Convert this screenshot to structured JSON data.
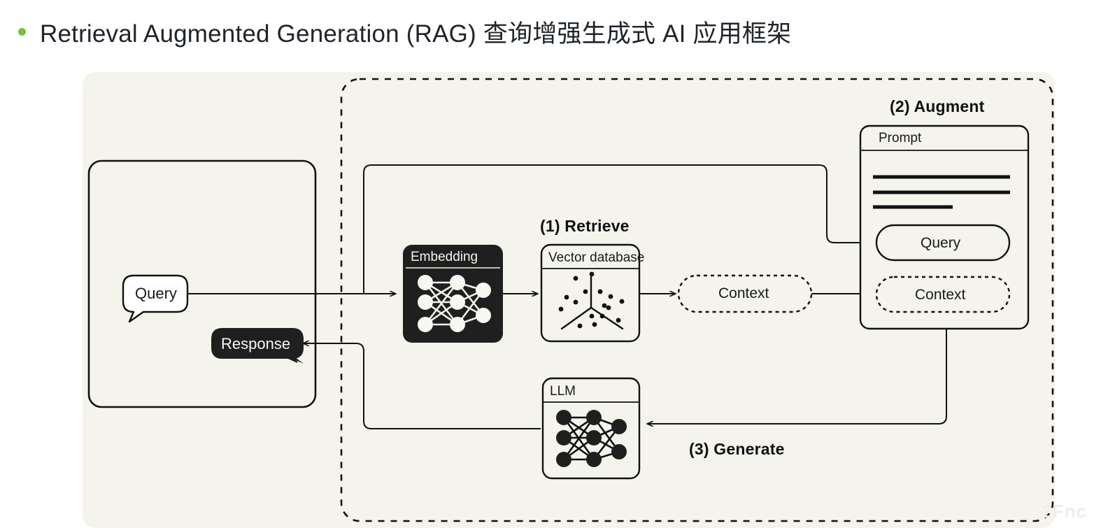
{
  "title": {
    "text": "Retrieval Augmented Generation (RAG) 查询增强生成式 AI 应用框架",
    "bullet_color": "#76c043"
  },
  "colors": {
    "canvas_bg": "#f4f3ec",
    "page_bg": "#ffffff",
    "stroke": "#111111",
    "dark_fill": "#1f1f1f",
    "light_text": "#f7f7f2"
  },
  "steps": [
    {
      "id": "retrieve",
      "label": "(1) Retrieve"
    },
    {
      "id": "augment",
      "label": "(2) Augment"
    },
    {
      "id": "generate",
      "label": "(3) Generate"
    }
  ],
  "user_panel": {
    "query_bubble": "Query",
    "response_bubble": "Response"
  },
  "blocks": {
    "embedding": {
      "title": "Embedding",
      "style": "dark",
      "network": "3-3-2"
    },
    "vector_database": {
      "title": "Vector database",
      "style": "light",
      "glyph": "3d-scatter"
    },
    "llm": {
      "title": "LLM",
      "style": "light",
      "network": "3-3-2"
    }
  },
  "context_node": {
    "label": "Context"
  },
  "prompt_panel": {
    "title": "Prompt",
    "lines": 3,
    "query_slot": "Query",
    "context_slot": "Context"
  },
  "watermark": {
    "text": "2Fnc"
  },
  "icons": {
    "arrow": "arrow-right-icon",
    "bullet": "bullet-dot-icon"
  }
}
